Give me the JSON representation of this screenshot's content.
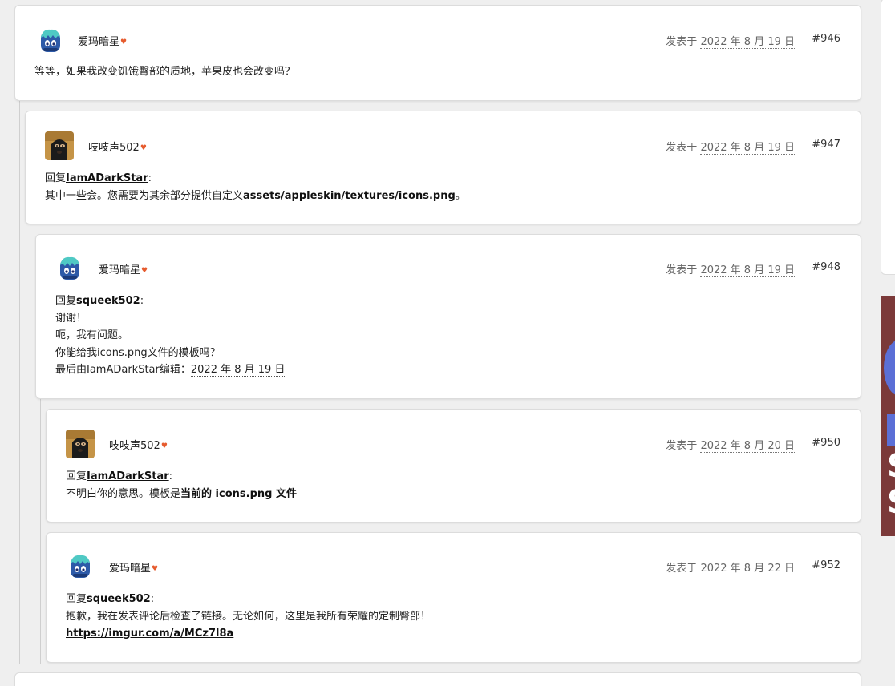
{
  "posts": [
    {
      "author": "爱玛暗星",
      "date_prefix": "发表于",
      "date": "2022 年 8 月 19 日",
      "number": "#946",
      "text": "等等，如果我改变饥饿臀部的质地，苹果皮也会改变吗？"
    },
    {
      "author": "吱吱声502",
      "date_prefix": "发表于",
      "date": "2022 年 8 月 19 日",
      "number": "#947",
      "reply_prefix": "回复",
      "reply_to": "IamADarkStar",
      "reply_colon": ":",
      "text_before": " 其中一些会。您需要为其余部分提供自定义",
      "link": "assets/appleskin/textures/icons.png",
      "text_after": "。"
    },
    {
      "author": "爱玛暗星",
      "date_prefix": "发表于",
      "date": "2022 年 8 月 19 日",
      "number": "#948",
      "reply_prefix": "回复",
      "reply_to": "squeek502",
      "reply_colon": ":",
      "line1": " 谢谢！",
      "line2": "呃，我有问题。",
      "line3": "你能给我icons.png文件的模板吗？",
      "edited_prefix": "最后由IamADarkStar编辑：",
      "edited_date": "2022 年 8 月 19 日"
    },
    {
      "author": "吱吱声502",
      "date_prefix": "发表于",
      "date": "2022 年 8 月 20 日",
      "number": "#950",
      "reply_prefix": "回复",
      "reply_to": "IamADarkStar",
      "reply_colon": ":",
      "text_before": " 不明白你的意思。模板是",
      "link": "当前的 icons.png 文件"
    },
    {
      "author": "爱玛暗星",
      "date_prefix": "发表于",
      "date": "2022 年 8 月 22 日",
      "number": "#952",
      "reply_prefix": "回复",
      "reply_to": "squeek502",
      "reply_colon": ":",
      "line1": " 抱歉，我在发表评论后检查了链接。无论如何，这里是我所有荣耀的定制臀部！",
      "link": "https://imgur.com/a/MCz7l8a"
    }
  ],
  "ad": {
    "letters": [
      "S",
      "S"
    ]
  },
  "colors": {
    "heart": "#e65b2e",
    "page_bg": "#efefef",
    "ad_bg": "#7b3939"
  },
  "icons": {
    "reputation": "heart-icon"
  }
}
